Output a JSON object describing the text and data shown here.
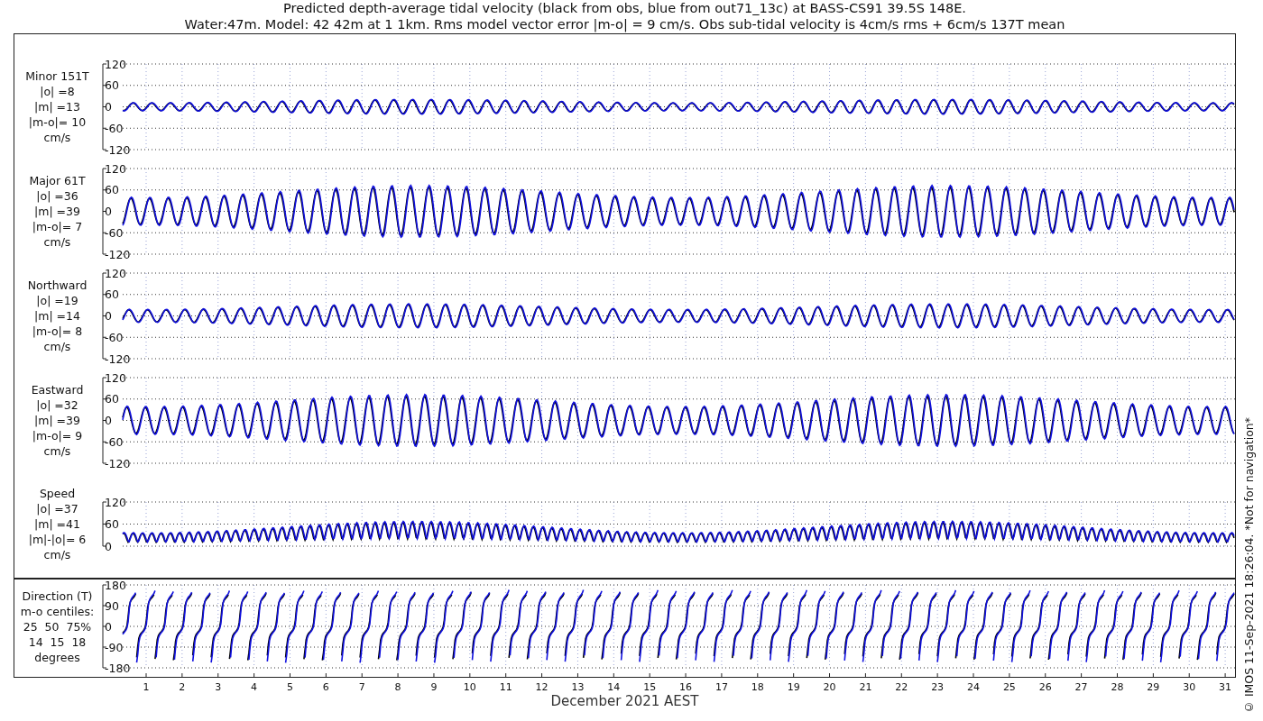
{
  "title_lines": [
    "Predicted depth-average tidal velocity (black from obs, blue from out71_13c) at BASS-CS91 39.5S 148E.",
    "Water:47m. Model: 42 42m at 1 1km. Rms model vector error |m-o| = 9 cm/s. Obs sub-tidal velocity is 4cm/s rms + 6cm/s 137T mean"
  ],
  "panels": [
    {
      "kind": "vector",
      "label_lines": [
        "Minor 151T",
        "|o| =8",
        "|m| =13",
        "|m-o|= 10",
        "cm/s"
      ],
      "yticks": [
        "120",
        "60",
        "0",
        "-60",
        "-120"
      ]
    },
    {
      "kind": "vector",
      "label_lines": [
        "Major 61T",
        "|o| =36",
        "|m| =39",
        "|m-o|= 7",
        "cm/s"
      ],
      "yticks": [
        "120",
        "60",
        "0",
        "-60",
        "-120"
      ]
    },
    {
      "kind": "vector",
      "label_lines": [
        "Northward",
        "|o| =19",
        "|m| =14",
        "|m-o|= 8",
        "cm/s"
      ],
      "yticks": [
        "120",
        "60",
        "0",
        "-60",
        "-120"
      ]
    },
    {
      "kind": "vector",
      "label_lines": [
        "Eastward",
        "|o| =32",
        "|m| =39",
        "|m-o|= 9",
        "cm/s"
      ],
      "yticks": [
        "120",
        "60",
        "0",
        "-60",
        "-120"
      ]
    },
    {
      "kind": "speed",
      "label_lines": [
        "Speed",
        "|o| =37",
        "|m| =41",
        "|m|-|o|= 6",
        "cm/s"
      ],
      "yticks": [
        "120",
        "60",
        "0"
      ]
    },
    {
      "kind": "direction",
      "label_lines": [
        "Direction (T)",
        "m-o centiles:",
        "25  50  75%",
        "14  15  18",
        "degrees"
      ],
      "yticks": [
        "180",
        "90",
        "0",
        "-90",
        "-180"
      ]
    }
  ],
  "xticks": [
    "1",
    "2",
    "3",
    "4",
    "5",
    "6",
    "7",
    "8",
    "9",
    "10",
    "11",
    "12",
    "13",
    "14",
    "15",
    "16",
    "17",
    "18",
    "19",
    "20",
    "21",
    "22",
    "23",
    "24",
    "25",
    "26",
    "27",
    "28",
    "29",
    "30",
    "31"
  ],
  "xlabel": "December 2021 AEST",
  "credit": "© IMOS 11-Sep-2021 18:26:04. *Not for navigation*"
}
